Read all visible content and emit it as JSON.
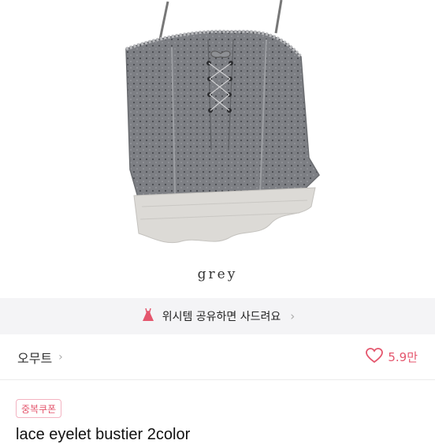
{
  "product": {
    "caption": "grey",
    "title": "lace eyelet bustier 2color"
  },
  "promo": {
    "icon": "dress-icon",
    "text": "위시템 공유하면 사드려요",
    "chevron": "›"
  },
  "shop": {
    "name": "오무트",
    "chevron": "›",
    "likes": "5.9만",
    "like_icon": "heart-outline-icon"
  },
  "badge": {
    "label": "중복쿠폰"
  },
  "colors": {
    "accent": "#e4566d",
    "banner_bg": "#f4f4f6",
    "top_grey": "#7b7d82",
    "ruffle": "#dcdad6"
  }
}
